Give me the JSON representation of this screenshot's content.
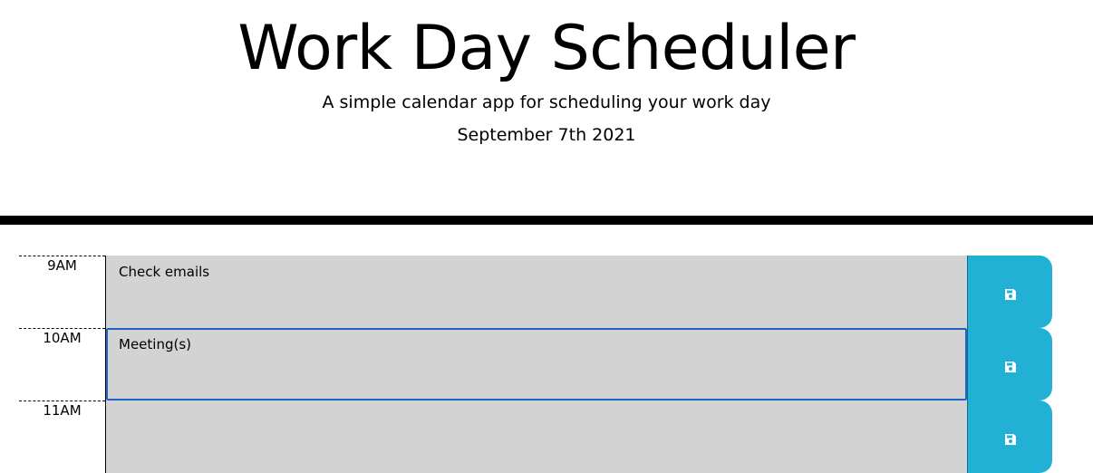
{
  "header": {
    "title": "Work Day Scheduler",
    "subtitle": "A simple calendar app for scheduling your work day",
    "date": "September 7th 2021"
  },
  "colors": {
    "save_button": "#20b1d5",
    "past_slot": "#d3d3d3",
    "focus_border": "#1f63c8"
  },
  "timeblocks": [
    {
      "hour": "9AM",
      "text": "Check emails",
      "save_icon": "save-icon"
    },
    {
      "hour": "10AM",
      "text": "Meeting(s)",
      "save_icon": "save-icon"
    },
    {
      "hour": "11AM",
      "text": "",
      "save_icon": "save-icon"
    }
  ]
}
